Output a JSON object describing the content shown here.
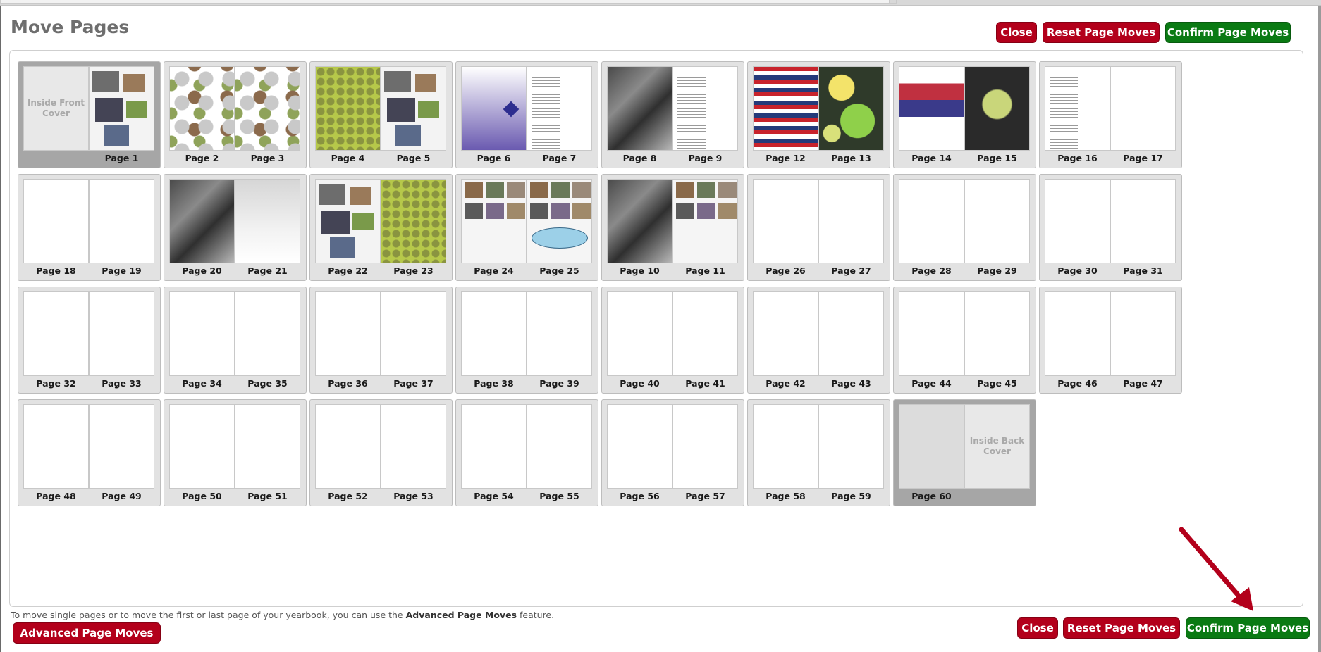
{
  "title": "Move Pages",
  "buttons": {
    "close": "Close",
    "reset": "Reset Page Moves",
    "confirm": "Confirm Page Moves",
    "advanced": "Advanced Page Moves"
  },
  "footer": {
    "note_prefix": "To move single pages or to move the first or last page of your yearbook, you can use the ",
    "note_link": "Advanced Page Moves",
    "note_suffix": " feature."
  },
  "covers": {
    "inside_front": "Inside Front Cover",
    "inside_back": "Inside Back Cover"
  },
  "spreads": [
    {
      "left": "",
      "right": "Page 1"
    },
    {
      "left": "Page 2",
      "right": "Page 3"
    },
    {
      "left": "Page 4",
      "right": "Page 5"
    },
    {
      "left": "Page 6",
      "right": "Page 7"
    },
    {
      "left": "Page 8",
      "right": "Page 9"
    },
    {
      "left": "Page 12",
      "right": "Page 13"
    },
    {
      "left": "Page 14",
      "right": "Page 15"
    },
    {
      "left": "Page 16",
      "right": "Page 17"
    },
    {
      "left": "Page 18",
      "right": "Page 19"
    },
    {
      "left": "Page 20",
      "right": "Page 21"
    },
    {
      "left": "Page 22",
      "right": "Page 23"
    },
    {
      "left": "Page 24",
      "right": "Page 25"
    },
    {
      "left": "Page 10",
      "right": "Page 11"
    },
    {
      "left": "Page 26",
      "right": "Page 27"
    },
    {
      "left": "Page 28",
      "right": "Page 29"
    },
    {
      "left": "Page 30",
      "right": "Page 31"
    },
    {
      "left": "Page 32",
      "right": "Page 33"
    },
    {
      "left": "Page 34",
      "right": "Page 35"
    },
    {
      "left": "Page 36",
      "right": "Page 37"
    },
    {
      "left": "Page 38",
      "right": "Page 39"
    },
    {
      "left": "Page 40",
      "right": "Page 41"
    },
    {
      "left": "Page 42",
      "right": "Page 43"
    },
    {
      "left": "Page 44",
      "right": "Page 45"
    },
    {
      "left": "Page 46",
      "right": "Page 47"
    },
    {
      "left": "Page 48",
      "right": "Page 49"
    },
    {
      "left": "Page 50",
      "right": "Page 51"
    },
    {
      "left": "Page 52",
      "right": "Page 53"
    },
    {
      "left": "Page 54",
      "right": "Page 55"
    },
    {
      "left": "Page 56",
      "right": "Page 57"
    },
    {
      "left": "Page 58",
      "right": "Page 59"
    },
    {
      "left": "Page 60",
      "right": ""
    }
  ],
  "colors": {
    "red_button": "#b3001b",
    "green_button": "#0a7a13",
    "title_gray": "#6e6e6e",
    "arrow_red": "#b3001b"
  },
  "icons": {
    "annotation": "red-arrow-icon"
  }
}
